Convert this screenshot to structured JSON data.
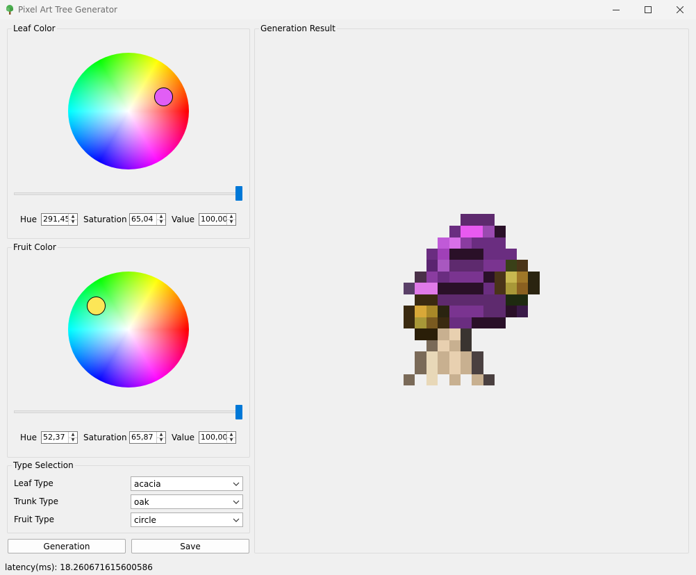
{
  "window": {
    "title": "Pixel Art Tree Generator",
    "icon": "tree-icon"
  },
  "leaf_color": {
    "group_label": "Leaf Color",
    "hue_label": "Hue",
    "hue": "291,45",
    "saturation_label": "Saturation",
    "saturation": "65,04",
    "value_label": "Value",
    "value": "100,00",
    "marker_color": "#e15ef5",
    "value_slider_level": 1.0
  },
  "fruit_color": {
    "group_label": "Fruit Color",
    "hue_label": "Hue",
    "hue": "52,37",
    "saturation_label": "Saturation",
    "saturation": "65,87",
    "value_label": "Value",
    "value": "100,00",
    "marker_color": "#fce657",
    "value_slider_level": 1.0
  },
  "type_selection": {
    "group_label": "Type Selection",
    "leaf_type_label": "Leaf Type",
    "leaf_type": "acacia",
    "trunk_type_label": "Trunk Type",
    "trunk_type": "oak",
    "fruit_type_label": "Fruit Type",
    "fruit_type": "circle"
  },
  "buttons": {
    "generation": "Generation",
    "save": "Save"
  },
  "result": {
    "group_label": "Generation Result"
  },
  "status": {
    "latency": "latency(ms): 18.260671615600586"
  },
  "colors": {
    "accent": "#0078d7"
  }
}
